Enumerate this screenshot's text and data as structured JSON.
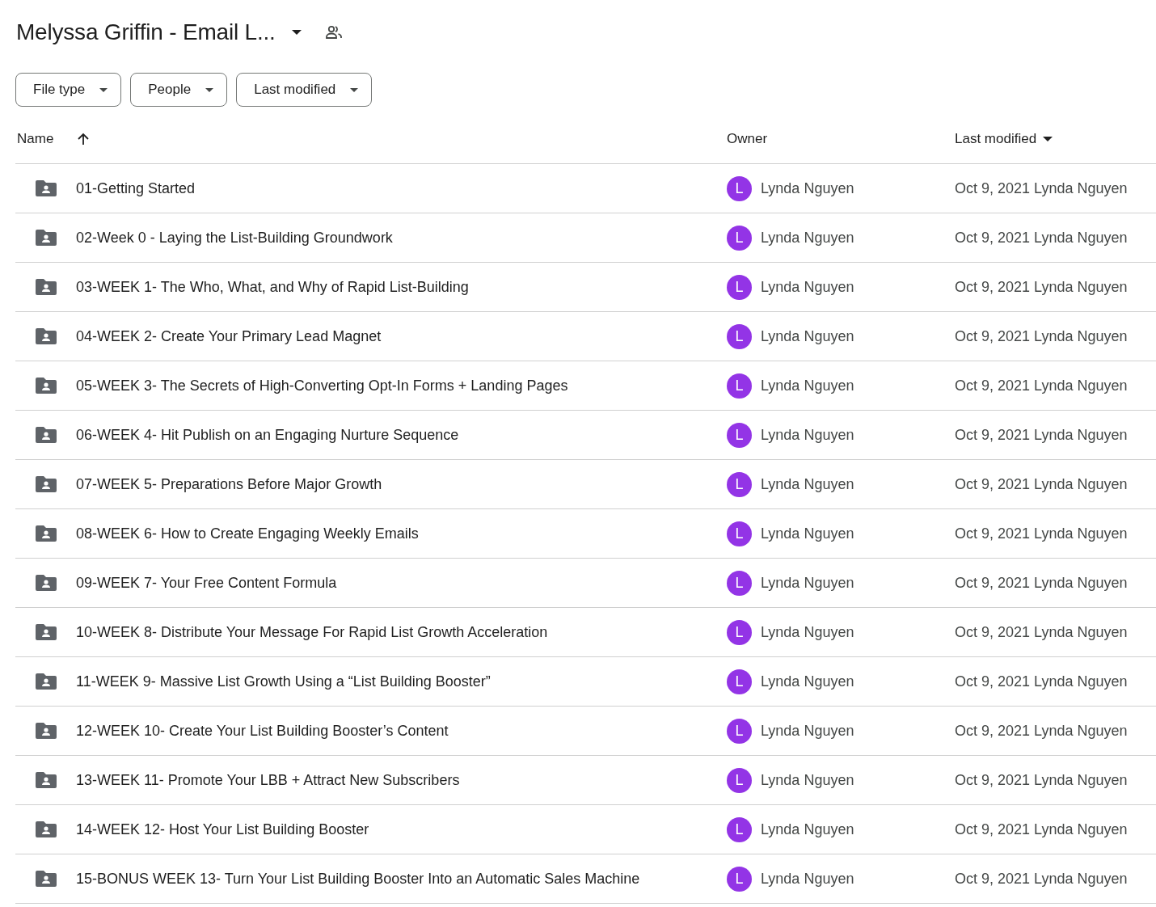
{
  "title": "Melyssa Griffin - Email L...",
  "filters": [
    "File type",
    "People",
    "Last modified"
  ],
  "columns": {
    "name": "Name",
    "owner": "Owner",
    "modified": "Last modified"
  },
  "rows": [
    {
      "name": "01-Getting Started",
      "initial": "L",
      "color": "#9334e6",
      "owner": "Lynda Nguyen",
      "modified": "Oct 9, 2021 Lynda Nguyen"
    },
    {
      "name": "02-Week 0 - Laying the List-Building Groundwork",
      "initial": "L",
      "color": "#9334e6",
      "owner": "Lynda Nguyen",
      "modified": "Oct 9, 2021 Lynda Nguyen"
    },
    {
      "name": "03-WEEK 1- The Who, What, and Why of Rapid List-Building",
      "initial": "L",
      "color": "#9334e6",
      "owner": "Lynda Nguyen",
      "modified": "Oct 9, 2021 Lynda Nguyen"
    },
    {
      "name": "04-WEEK 2- Create Your Primary Lead Magnet",
      "initial": "L",
      "color": "#9334e6",
      "owner": "Lynda Nguyen",
      "modified": "Oct 9, 2021 Lynda Nguyen"
    },
    {
      "name": "05-WEEK 3- The Secrets of High-Converting Opt-In Forms + Landing Pages",
      "initial": "L",
      "color": "#9334e6",
      "owner": "Lynda Nguyen",
      "modified": "Oct 9, 2021 Lynda Nguyen"
    },
    {
      "name": "06-WEEK 4- Hit Publish on an Engaging Nurture Sequence",
      "initial": "L",
      "color": "#9334e6",
      "owner": "Lynda Nguyen",
      "modified": "Oct 9, 2021 Lynda Nguyen"
    },
    {
      "name": "07-WEEK 5- Preparations Before Major Growth",
      "initial": "L",
      "color": "#9334e6",
      "owner": "Lynda Nguyen",
      "modified": "Oct 9, 2021 Lynda Nguyen"
    },
    {
      "name": "08-WEEK 6- How to Create Engaging Weekly Emails",
      "initial": "L",
      "color": "#9334e6",
      "owner": "Lynda Nguyen",
      "modified": "Oct 9, 2021 Lynda Nguyen"
    },
    {
      "name": "09-WEEK 7- Your Free Content Formula",
      "initial": "L",
      "color": "#9334e6",
      "owner": "Lynda Nguyen",
      "modified": "Oct 9, 2021 Lynda Nguyen"
    },
    {
      "name": "10-WEEK 8- Distribute Your Message For Rapid List Growth Acceleration",
      "initial": "L",
      "color": "#9334e6",
      "owner": "Lynda Nguyen",
      "modified": "Oct 9, 2021 Lynda Nguyen"
    },
    {
      "name": "11-WEEK 9- Massive List Growth Using a “List Building Booster”",
      "initial": "L",
      "color": "#9334e6",
      "owner": "Lynda Nguyen",
      "modified": "Oct 9, 2021 Lynda Nguyen"
    },
    {
      "name": "12-WEEK 10- Create Your List Building Booster’s Content",
      "initial": "L",
      "color": "#9334e6",
      "owner": "Lynda Nguyen",
      "modified": "Oct 9, 2021 Lynda Nguyen"
    },
    {
      "name": "13-WEEK 11- Promote Your LBB + Attract New Subscribers",
      "initial": "L",
      "color": "#9334e6",
      "owner": "Lynda Nguyen",
      "modified": "Oct 9, 2021 Lynda Nguyen"
    },
    {
      "name": "14-WEEK 12- Host Your List Building Booster",
      "initial": "L",
      "color": "#9334e6",
      "owner": "Lynda Nguyen",
      "modified": "Oct 9, 2021 Lynda Nguyen"
    },
    {
      "name": "15-BONUS WEEK 13- Turn Your List Building Booster Into an Automatic Sales Machine",
      "initial": "L",
      "color": "#9334e6",
      "owner": "Lynda Nguyen",
      "modified": "Oct 9, 2021 Lynda Nguyen"
    }
  ]
}
